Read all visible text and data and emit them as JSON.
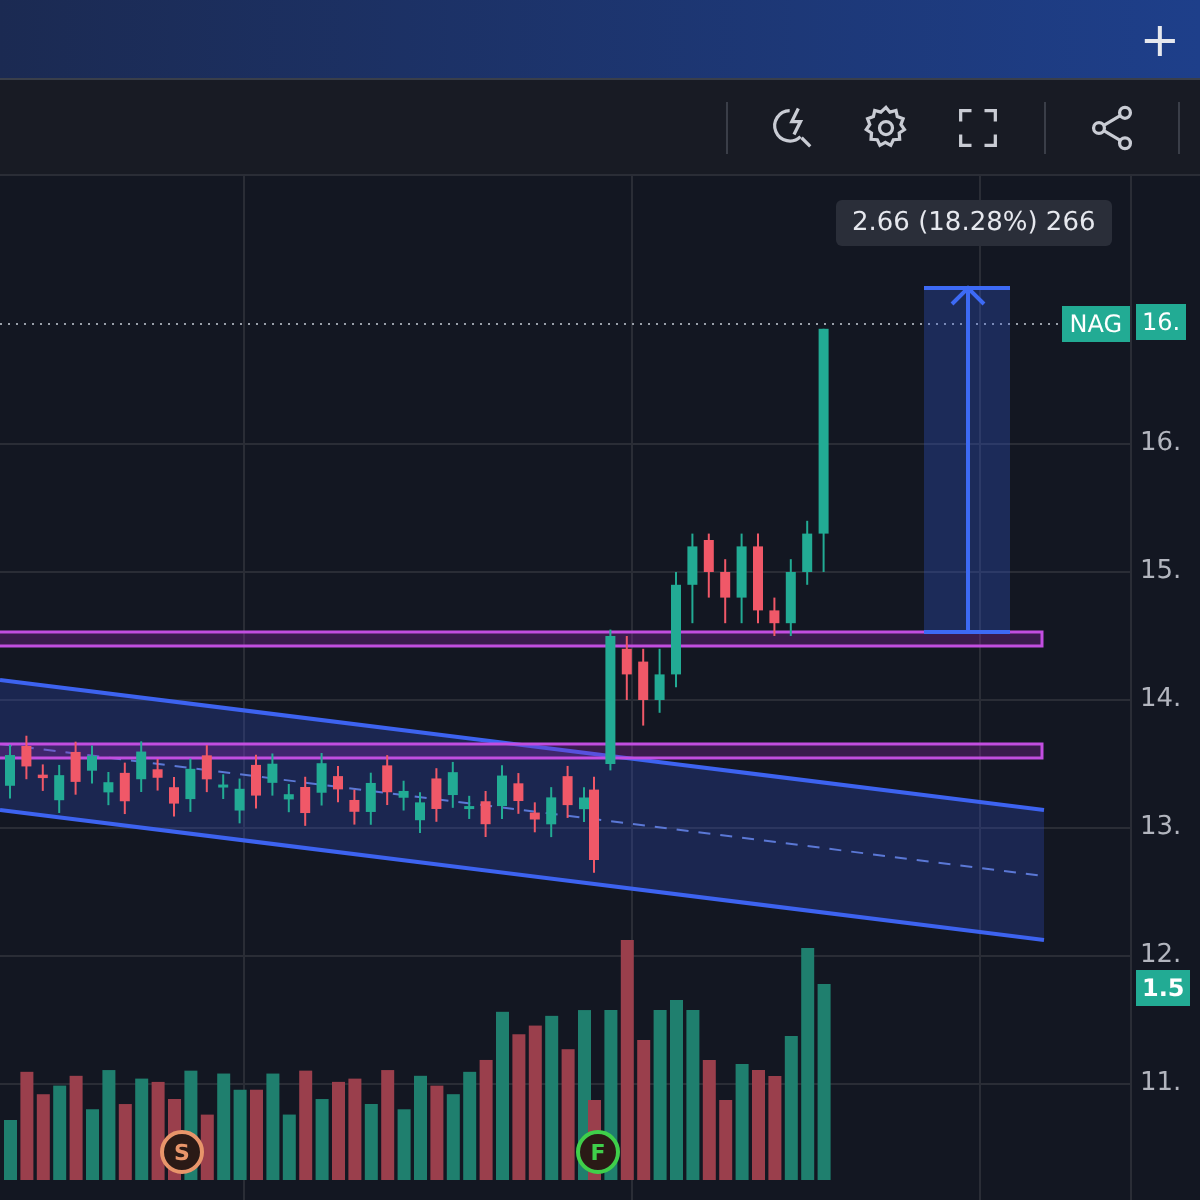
{
  "top_bar": {
    "new_tab": "+"
  },
  "measure": {
    "label": "2.66 (18.28%) 266"
  },
  "price_axis": {
    "labels": [
      "16.",
      "15.",
      "14.",
      "13.",
      "12.",
      "11."
    ]
  },
  "last_price": {
    "symbol": "NAG",
    "price": "16."
  },
  "volume_badge": "1.5",
  "events": [
    {
      "letter": "S",
      "color": "#e8956a"
    },
    {
      "letter": "F",
      "color": "#3fcf4a"
    }
  ]
}
